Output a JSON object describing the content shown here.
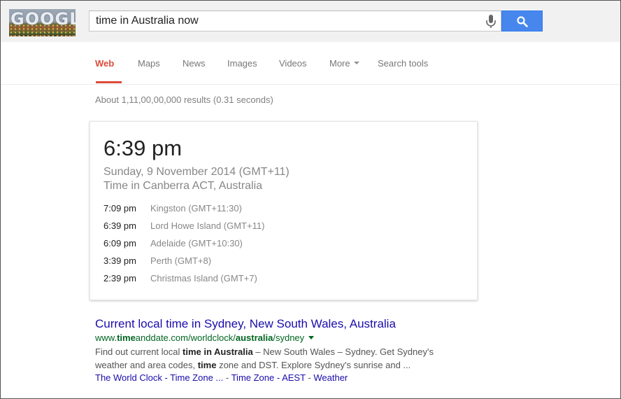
{
  "header": {
    "logo_text": "GOOGLE",
    "search_value": "time in Australia now"
  },
  "tabs": [
    {
      "label": "Web",
      "active": true
    },
    {
      "label": "Maps"
    },
    {
      "label": "News"
    },
    {
      "label": "Images"
    },
    {
      "label": "Videos"
    },
    {
      "label": "More"
    },
    {
      "label": "Search tools"
    }
  ],
  "result_stats": "About 1,11,00,00,000 results (0.31 seconds)",
  "time_card": {
    "time": "6:39 pm",
    "date": "Sunday, 9 November 2014 (GMT+11)",
    "place": "Time in Canberra ACT, Australia",
    "zones": [
      {
        "time": "7:09 pm",
        "name": "Kingston (GMT+11:30)"
      },
      {
        "time": "6:39 pm",
        "name": "Lord Howe Island (GMT+11)"
      },
      {
        "time": "6:09 pm",
        "name": "Adelaide (GMT+10:30)"
      },
      {
        "time": "3:39 pm",
        "name": "Perth (GMT+8)"
      },
      {
        "time": "2:39 pm",
        "name": "Christmas Island (GMT+7)"
      }
    ]
  },
  "result": {
    "title": "Current local time in Sydney, New South Wales, Australia",
    "url_prefix": "www.",
    "url_bold1": "time",
    "url_mid": "anddate.com/worldclock/",
    "url_bold2": "australia",
    "url_suffix": "/sydney",
    "snippet_1": "Find out current local ",
    "snippet_b1": "time in Australia",
    "snippet_2": " – New South Wales – Sydney. Get Sydney's weather and area codes, ",
    "snippet_b2": "time",
    "snippet_3": " zone and DST. Explore Sydney's sunrise and ...",
    "sitelinks": [
      "The World Clock - Time Zone ...",
      "Time Zone - AEST",
      "Weather"
    ],
    "sitelink_sep": " - "
  },
  "colors": {
    "accent_red": "#dd4b39",
    "link_blue": "#1a0dab",
    "url_green": "#006621",
    "search_blue": "#4787ed"
  }
}
